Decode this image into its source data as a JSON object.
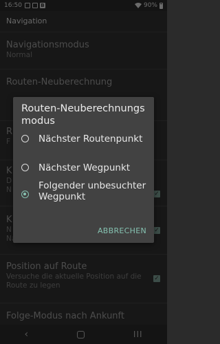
{
  "status_bar": {
    "time": "16:50",
    "battery": "90%",
    "app_icon_letter": "B"
  },
  "settings": {
    "section_header": "Navigation",
    "items": [
      {
        "title": "Navigationsmodus",
        "subtitle": "Normal"
      },
      {
        "title": "Routen-Neuberechnung",
        "subtitle": ""
      },
      {
        "title": "R",
        "subtitle": "F"
      },
      {
        "title": "K",
        "subtitle": "D\nN"
      },
      {
        "title": "K",
        "subtitle": "N\nNavigation"
      },
      {
        "title": "Position auf Route",
        "subtitle": "Versuche die aktuelle Position auf die Route zu legen",
        "checked": true
      },
      {
        "title": "Folge-Modus nach Ankunft",
        "subtitle": ""
      }
    ]
  },
  "dialog": {
    "title": "Routen-Neuberechnungs modus",
    "options": [
      {
        "label": "Nächster Routenpunkt",
        "selected": false
      },
      {
        "label": "Nächster Wegpunkt",
        "selected": false
      },
      {
        "label": "Folgender unbesuchter Wegpunkt",
        "selected": true
      }
    ],
    "cancel_label": "ABBRECHEN"
  },
  "nav_bar": {
    "back_glyph": "‹",
    "recent_glyph": "III"
  },
  "colors": {
    "accent": "#86c2b1",
    "dialog_bg": "#424242",
    "background": "#2b2b2b"
  }
}
